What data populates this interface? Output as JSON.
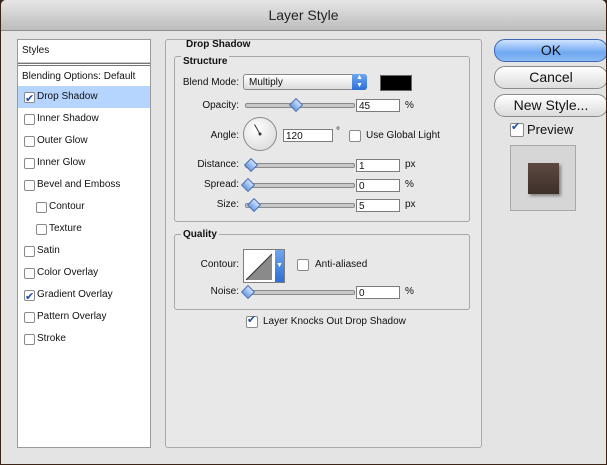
{
  "window": {
    "title": "Layer Style"
  },
  "styles_list": {
    "header": "Styles",
    "blending": "Blending Options: Default",
    "items": [
      {
        "label": "Drop Shadow",
        "checked": true,
        "selected": true,
        "indent": false
      },
      {
        "label": "Inner Shadow",
        "checked": false,
        "selected": false,
        "indent": false
      },
      {
        "label": "Outer Glow",
        "checked": false,
        "selected": false,
        "indent": false
      },
      {
        "label": "Inner Glow",
        "checked": false,
        "selected": false,
        "indent": false
      },
      {
        "label": "Bevel and Emboss",
        "checked": false,
        "selected": false,
        "indent": false
      },
      {
        "label": "Contour",
        "checked": false,
        "selected": false,
        "indent": true
      },
      {
        "label": "Texture",
        "checked": false,
        "selected": false,
        "indent": true
      },
      {
        "label": "Satin",
        "checked": false,
        "selected": false,
        "indent": false
      },
      {
        "label": "Color Overlay",
        "checked": false,
        "selected": false,
        "indent": false
      },
      {
        "label": "Gradient Overlay",
        "checked": true,
        "selected": false,
        "indent": false
      },
      {
        "label": "Pattern Overlay",
        "checked": false,
        "selected": false,
        "indent": false
      },
      {
        "label": "Stroke",
        "checked": false,
        "selected": false,
        "indent": false
      }
    ]
  },
  "drop_shadow": {
    "title": "Drop Shadow",
    "structure": {
      "title": "Structure",
      "blend_mode_label": "Blend Mode:",
      "blend_mode_value": "Multiply",
      "shadow_color": "#000000",
      "opacity_label": "Opacity:",
      "opacity_value": "45",
      "opacity_unit": "%",
      "opacity_fraction": 0.45,
      "angle_label": "Angle:",
      "angle_value": "120",
      "angle_unit": "°",
      "use_global_light_label": "Use Global Light",
      "use_global_light": false,
      "distance_label": "Distance:",
      "distance_value": "1",
      "distance_unit": "px",
      "spread_label": "Spread:",
      "spread_value": "0",
      "spread_unit": "%",
      "size_label": "Size:",
      "size_value": "5",
      "size_unit": "px"
    },
    "quality": {
      "title": "Quality",
      "contour_label": "Contour:",
      "anti_aliased_label": "Anti-aliased",
      "anti_aliased": false,
      "noise_label": "Noise:",
      "noise_value": "0",
      "noise_unit": "%"
    },
    "knocks_out_label": "Layer Knocks Out Drop Shadow",
    "knocks_out": true
  },
  "buttons": {
    "ok": "OK",
    "cancel": "Cancel",
    "new_style": "New Style...",
    "preview_label": "Preview",
    "preview_checked": true
  },
  "colors": {
    "accent": "#6fa8f2",
    "selection": "#b5d5ff",
    "preview_swatch": "#4e3c35"
  }
}
